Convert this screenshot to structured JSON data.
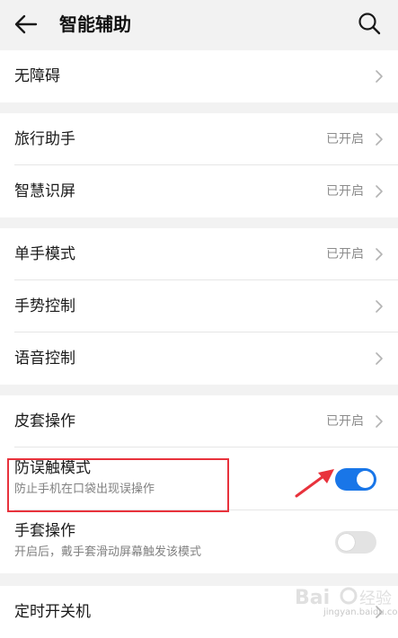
{
  "header": {
    "title": "智能辅助",
    "back_icon": "arrow-left-icon",
    "search_icon": "search-icon"
  },
  "groups": [
    {
      "items": [
        {
          "title": "无障碍",
          "status": "",
          "control": "chevron"
        }
      ]
    },
    {
      "items": [
        {
          "title": "旅行助手",
          "status": "已开启",
          "control": "chevron"
        },
        {
          "title": "智慧识屏",
          "status": "已开启",
          "control": "chevron"
        }
      ]
    },
    {
      "items": [
        {
          "title": "单手模式",
          "status": "已开启",
          "control": "chevron"
        },
        {
          "title": "手势控制",
          "status": "",
          "control": "chevron"
        },
        {
          "title": "语音控制",
          "status": "",
          "control": "chevron"
        }
      ]
    },
    {
      "items": [
        {
          "title": "皮套操作",
          "status": "已开启",
          "control": "chevron"
        },
        {
          "title": "防误触模式",
          "subtitle": "防止手机在口袋出现误操作",
          "control": "toggle",
          "toggle_on": true
        },
        {
          "title": "手套操作",
          "subtitle": "开启后，戴手套滑动屏幕触发该模式",
          "control": "toggle",
          "toggle_on": false
        }
      ]
    },
    {
      "items": [
        {
          "title": "定时开关机",
          "status": "",
          "control": "chevron"
        }
      ]
    }
  ],
  "annotation": {
    "highlight_color": "#e8323c",
    "arrow_color": "#e8323c"
  },
  "watermark": {
    "text": "jingyan.baidu.com"
  },
  "colors": {
    "accent": "#1976e8",
    "background": "#f2f2f2",
    "card": "#ffffff"
  }
}
